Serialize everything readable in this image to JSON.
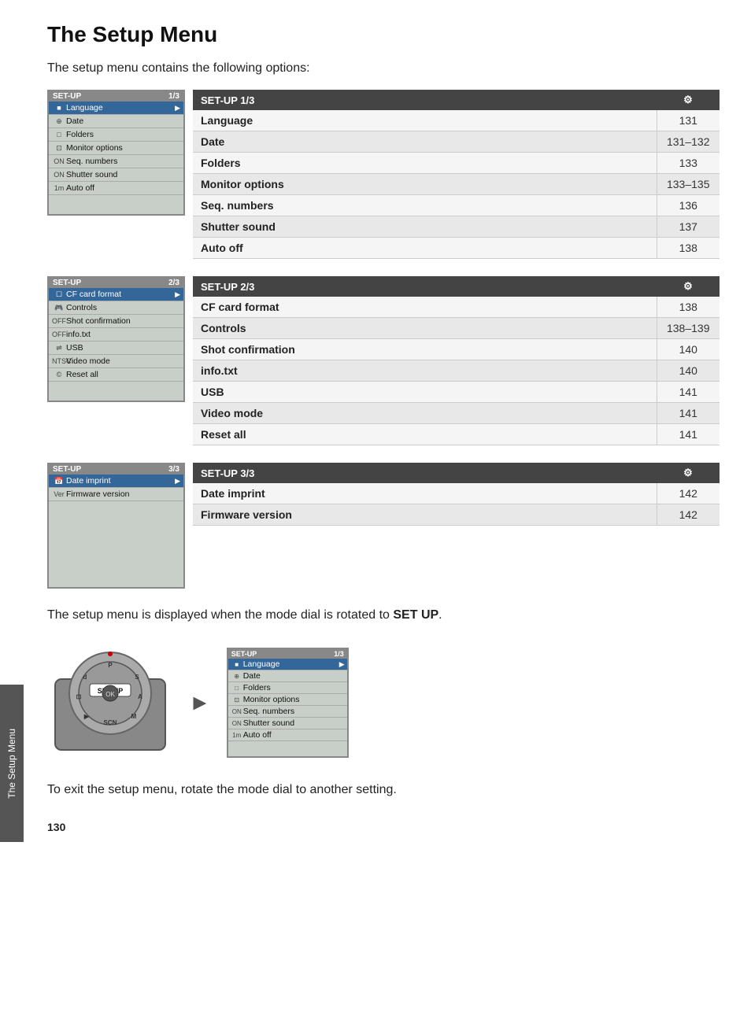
{
  "page": {
    "title": "The Setup Menu",
    "intro": "The setup menu contains the following options:",
    "bottom_text_1": "The setup menu is displayed when the mode dial is rotated to ",
    "bottom_text_bold": "SET UP",
    "bottom_text_2": ".",
    "exit_text": "To exit the setup menu, rotate the mode dial to another setting.",
    "page_number": "130",
    "side_tab_label": "The Setup Menu"
  },
  "sections": [
    {
      "id": "setup_1_3",
      "lcd": {
        "header_title": "SET-UP",
        "header_page": "1/3",
        "rows": [
          {
            "icon": "■",
            "label": "Language",
            "selected": true,
            "arrow": "▶"
          },
          {
            "icon": "⊕",
            "label": "Date",
            "selected": false,
            "arrow": ""
          },
          {
            "icon": "□",
            "label": "Folders",
            "selected": false,
            "arrow": ""
          },
          {
            "icon": "⊡",
            "label": "Monitor options",
            "selected": false,
            "arrow": ""
          },
          {
            "icon": "ON",
            "label": "Seq. numbers",
            "selected": false,
            "arrow": ""
          },
          {
            "icon": "ON",
            "label": "Shutter sound",
            "selected": false,
            "arrow": ""
          },
          {
            "icon": "1m",
            "label": "Auto off",
            "selected": false,
            "arrow": ""
          }
        ]
      },
      "table": {
        "header_label": "SET-UP 1/3",
        "header_icon": "⚙",
        "rows": [
          {
            "label": "Language",
            "page": "131"
          },
          {
            "label": "Date",
            "page": "131–132"
          },
          {
            "label": "Folders",
            "page": "133"
          },
          {
            "label": "Monitor options",
            "page": "133–135"
          },
          {
            "label": "Seq. numbers",
            "page": "136"
          },
          {
            "label": "Shutter sound",
            "page": "137"
          },
          {
            "label": "Auto off",
            "page": "138"
          }
        ]
      }
    },
    {
      "id": "setup_2_3",
      "lcd": {
        "header_title": "SET-UP",
        "header_page": "2/3",
        "rows": [
          {
            "icon": "☐",
            "label": "CF card format",
            "selected": true,
            "arrow": "▶"
          },
          {
            "icon": "🎮",
            "label": "Controls",
            "selected": false,
            "arrow": ""
          },
          {
            "icon": "OFF",
            "label": "Shot confirmation",
            "selected": false,
            "arrow": ""
          },
          {
            "icon": "OFF",
            "label": "info.txt",
            "selected": false,
            "arrow": ""
          },
          {
            "icon": "⇌",
            "label": "USB",
            "selected": false,
            "arrow": ""
          },
          {
            "icon": "NTSC",
            "label": "Video mode",
            "selected": false,
            "arrow": ""
          },
          {
            "icon": "©",
            "label": "Reset all",
            "selected": false,
            "arrow": ""
          }
        ]
      },
      "table": {
        "header_label": "SET-UP 2/3",
        "header_icon": "⚙",
        "rows": [
          {
            "label": "CF card format",
            "page": "138"
          },
          {
            "label": "Controls",
            "page": "138–139"
          },
          {
            "label": "Shot confirmation",
            "page": "140"
          },
          {
            "label": "info.txt",
            "page": "140"
          },
          {
            "label": "USB",
            "page": "141"
          },
          {
            "label": "Video mode",
            "page": "141"
          },
          {
            "label": "Reset all",
            "page": "141"
          }
        ]
      }
    },
    {
      "id": "setup_3_3",
      "lcd": {
        "header_title": "SET-UP",
        "header_page": "3/3",
        "rows": [
          {
            "icon": "📅",
            "label": "Date imprint",
            "selected": true,
            "arrow": "▶"
          },
          {
            "icon": "Ver",
            "label": "Firmware version",
            "selected": false,
            "arrow": ""
          }
        ]
      },
      "table": {
        "header_label": "SET-UP 3/3",
        "header_icon": "⚙",
        "rows": [
          {
            "label": "Date imprint",
            "page": "142"
          },
          {
            "label": "Firmware version",
            "page": "142"
          }
        ]
      }
    }
  ],
  "lcd_small": {
    "header_title": "SET-UP",
    "header_page": "1/3",
    "rows": [
      {
        "icon": "■",
        "label": "Language",
        "selected": true,
        "arrow": "▶"
      },
      {
        "icon": "⊕",
        "label": "Date",
        "selected": false
      },
      {
        "icon": "□",
        "label": "Folders",
        "selected": false
      },
      {
        "icon": "⊡",
        "label": "Monitor options",
        "selected": false
      },
      {
        "icon": "ON",
        "label": "Seq. numbers",
        "selected": false
      },
      {
        "icon": "ON",
        "label": "Shutter sound",
        "selected": false
      },
      {
        "icon": "1m",
        "label": "Auto off",
        "selected": false
      }
    ]
  }
}
